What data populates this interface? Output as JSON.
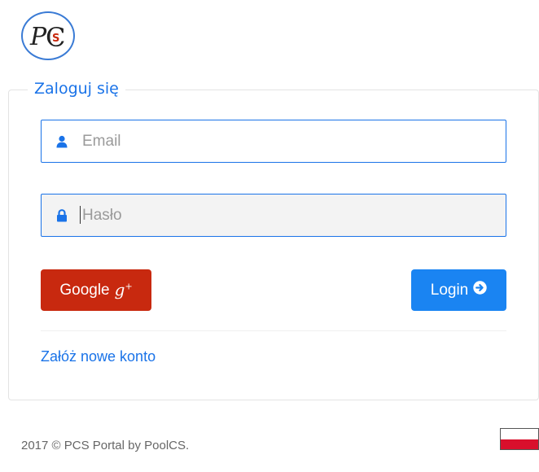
{
  "logo": {
    "text_p": "P",
    "text_c": "C",
    "text_s": "S",
    "ring_color": "#3a7bd5",
    "s_color": "#c8290f"
  },
  "form": {
    "legend": "Zaloguj się",
    "email": {
      "placeholder": "Email",
      "icon": "user-icon",
      "value": ""
    },
    "password": {
      "placeholder": "Hasło",
      "icon": "lock-icon",
      "value": ""
    },
    "google_button": {
      "label": "Google",
      "icon": "google-plus-icon",
      "icon_text": "g",
      "icon_sup": "+",
      "color": "#c8290f"
    },
    "login_button": {
      "label": "Login",
      "icon": "arrow-circle-right-icon",
      "color": "#1a84f2"
    },
    "register_link": "Załóż nowe konto",
    "accent_color": "#1a73e8"
  },
  "footer": {
    "copyright": "2017 © PCS Portal by PoolCS."
  },
  "language": {
    "flag": "poland-flag-icon",
    "colors": [
      "#ffffff",
      "#d90f2c"
    ]
  }
}
